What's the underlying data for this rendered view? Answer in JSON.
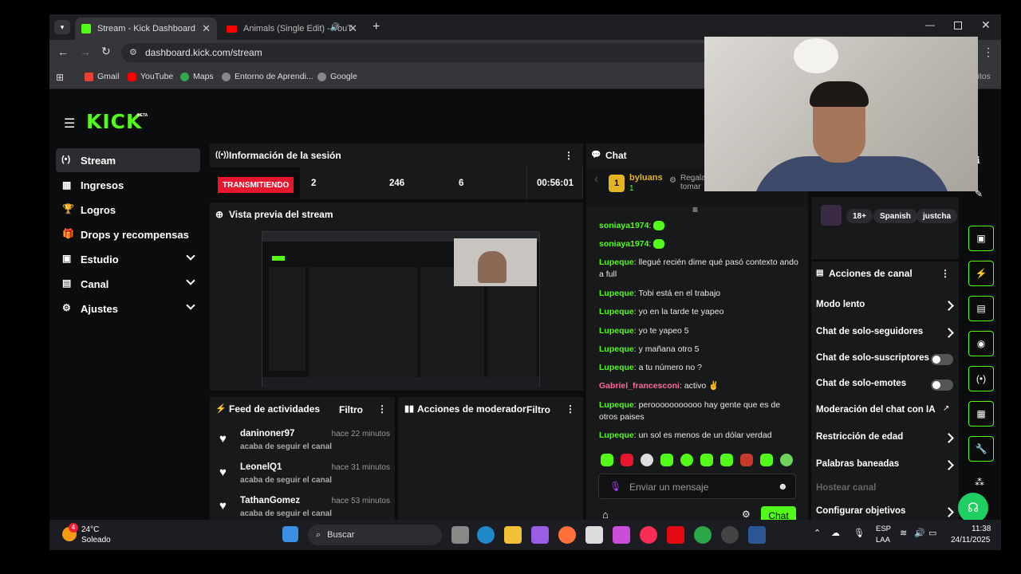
{
  "browser": {
    "tabs": [
      {
        "title": "Stream - Kick Dashboard",
        "active": true
      },
      {
        "title": "Animals (Single Edit) - YouT",
        "active": false
      }
    ],
    "url": "dashboard.kick.com/stream",
    "bookmarks": [
      "Gmail",
      "YouTube",
      "Maps",
      "Entorno de Aprendi...",
      "Google"
    ],
    "bookmarks_right": "ritos"
  },
  "logo": "KICK",
  "logo_badge": "BETA",
  "sidebar": {
    "items": [
      {
        "label": "Stream",
        "icon": "broadcast-icon",
        "active": true
      },
      {
        "label": "Ingresos",
        "icon": "revenue-icon"
      },
      {
        "label": "Logros",
        "icon": "trophy-icon"
      },
      {
        "label": "Drops y recompensas",
        "icon": "gift-icon"
      },
      {
        "label": "Estudio",
        "icon": "studio-icon",
        "expandable": true
      },
      {
        "label": "Canal",
        "icon": "channel-icon",
        "expandable": true
      },
      {
        "label": "Ajustes",
        "icon": "gear-icon",
        "expandable": true
      }
    ]
  },
  "session": {
    "title": "Información de la sesión",
    "status": "TRANSMITIENDO",
    "stats": [
      "2",
      "246",
      "6",
      "00:56:01"
    ]
  },
  "preview": {
    "title": "Vista previa del stream"
  },
  "activity": {
    "title": "Feed de actividades",
    "filter": "Filtro",
    "items": [
      {
        "name": "daninoner97",
        "time": "hace 22 minutos",
        "desc": "acaba de seguir el canal"
      },
      {
        "name": "LeonelQ1",
        "time": "hace 31 minutos",
        "desc": "acaba de seguir el canal"
      },
      {
        "name": "TathanGomez",
        "time": "hace 53 minutos",
        "desc": "acaba de seguir el canal"
      }
    ]
  },
  "moderator": {
    "title": "Acciones de moderador",
    "filter": "Filtro"
  },
  "chat": {
    "title": "Chat",
    "pinned_user": "byluans",
    "pinned_rank": "1",
    "pinned_sub": "1",
    "pinned_text_1": "Regala",
    "pinned_text_2": "tomar",
    "messages": [
      {
        "user": "soniaya1974",
        "text": ""
      },
      {
        "user": "soniaya1974",
        "text": ""
      },
      {
        "user": "Lupeque",
        "text": "llegué recién dime qué pasó contexto ando a full"
      },
      {
        "user": "Lupeque",
        "text": "Tobi está en el trabajo"
      },
      {
        "user": "Lupeque",
        "text": "yo en la tarde te yapeo"
      },
      {
        "user": "Lupeque",
        "text": "yo te yapeo 5"
      },
      {
        "user": "Lupeque",
        "text": "y mañana otro 5"
      },
      {
        "user": "Lupeque",
        "text": "a tu número no ?"
      },
      {
        "user": "Gabriel_francesconi",
        "text": "activo ✌"
      },
      {
        "user": "Lupeque",
        "text": "perooooooooooo hay gente que es de otros paises"
      },
      {
        "user": "Lupeque",
        "text": "un sol es menos de un dólar verdad"
      }
    ],
    "placeholder": "Enviar un mensaje",
    "send": "Chat"
  },
  "stream_info": {
    "tags": [
      "18+",
      "Spanish",
      "justcha"
    ]
  },
  "channel_actions": {
    "title": "Acciones de canal",
    "items": [
      {
        "label": "Modo lento",
        "kind": "chevron"
      },
      {
        "label": "Chat de solo-seguidores",
        "kind": "chevron"
      },
      {
        "label": "Chat de solo-suscriptores",
        "kind": "toggle"
      },
      {
        "label": "Chat de solo-emotes",
        "kind": "toggle"
      },
      {
        "label": "Moderación del chat con IA",
        "kind": "link"
      },
      {
        "label": "Restricción de edad",
        "kind": "chevron"
      },
      {
        "label": "Palabras baneadas",
        "kind": "chevron"
      },
      {
        "label": "Hostear canal",
        "kind": "disabled"
      },
      {
        "label": "Configurar objetivos",
        "kind": "chevron"
      }
    ]
  },
  "taskbar": {
    "weather_temp": "24°C",
    "weather_desc": "Soleado",
    "weather_badge": "4",
    "search": "Buscar",
    "lang_1": "ESP",
    "lang_2": "LAA",
    "time": "11:38",
    "date": "24/11/2025"
  },
  "colors": {
    "accent": "#53fc18",
    "live": "#e8152e",
    "panel": "#18191b",
    "background": "#0b0c0d"
  }
}
